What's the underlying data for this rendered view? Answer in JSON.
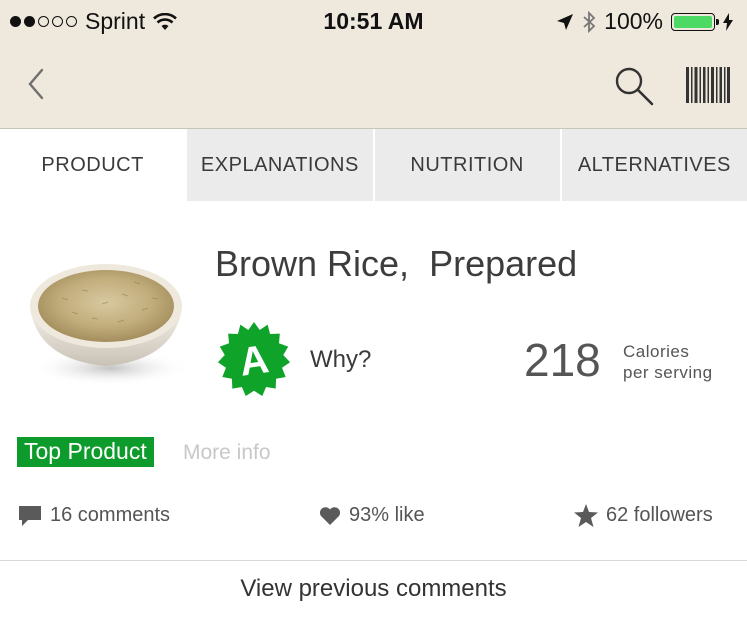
{
  "status_bar": {
    "carrier": "Sprint",
    "time": "10:51 AM",
    "battery_percent": "100%",
    "signal_bars_filled": 2,
    "signal_bars_total": 5
  },
  "navbar": {
    "back_icon": "chevron-left-icon",
    "search_icon": "search-icon",
    "barcode_icon": "barcode-icon"
  },
  "tabs": [
    {
      "label": "PRODUCT",
      "active": true
    },
    {
      "label": "EXPLANATIONS",
      "active": false
    },
    {
      "label": "NUTRITION",
      "active": false
    },
    {
      "label": "ALTERNATIVES",
      "active": false
    }
  ],
  "product": {
    "title": "Brown Rice,  Prepared",
    "grade": "A",
    "grade_color": "#10a32a",
    "why_label": "Why?",
    "calories": "218",
    "calories_label_line1": "Calories",
    "calories_label_line2": "per serving",
    "top_product_label": "Top Product",
    "top_product_color": "#0d9b2b",
    "more_info_label": "More info"
  },
  "stats": {
    "comments": "16 comments",
    "like": "93% like",
    "followers": "62 followers"
  },
  "view_previous_comments": "View previous comments"
}
